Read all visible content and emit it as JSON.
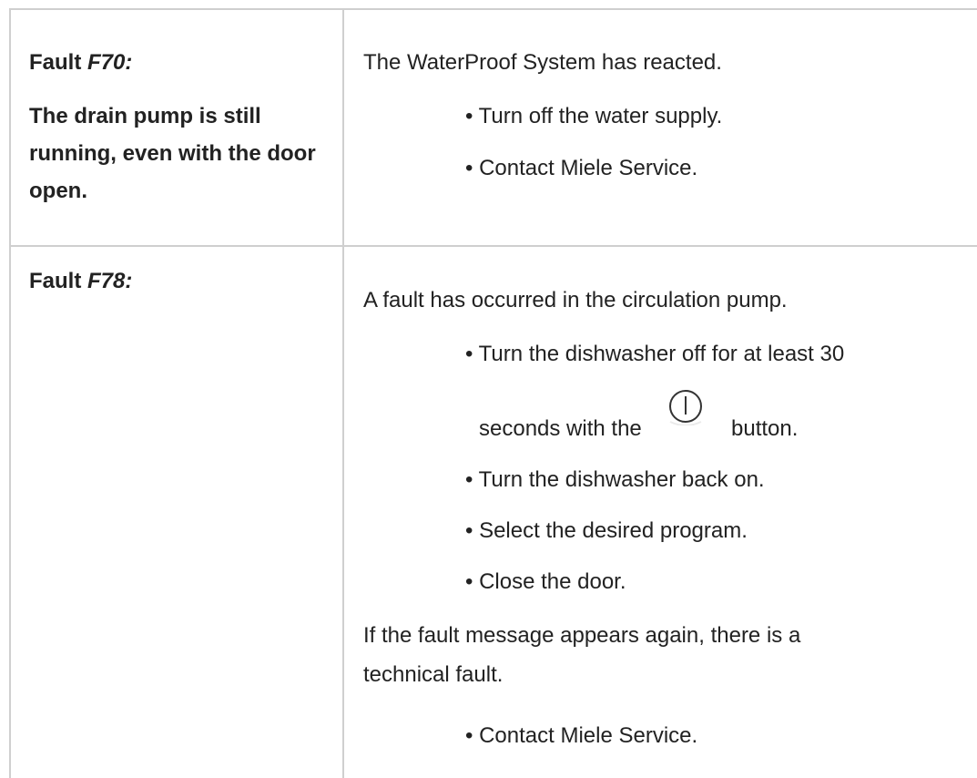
{
  "rows": [
    {
      "fault_prefix": "Fault ",
      "fault_code": "F70:",
      "description": "The drain pump is still running, even with the door open.",
      "message": "The WaterProof System has reacted.",
      "bullets": [
        "• Turn off the water supply.",
        "• Contact Miele Service."
      ]
    },
    {
      "fault_prefix": "Fault ",
      "fault_code": "F78:",
      "message": "A fault has occurred in the circulation pump.",
      "bullets": [
        "• Turn the dishwasher off for at least 30",
        "seconds with the",
        "button.",
        "• Turn the dishwasher back on.",
        "• Select the desired program.",
        "• Close the door."
      ],
      "followup": [
        "If the fault message appears again, there is a",
        "technical fault."
      ],
      "final_bullet": "• Contact Miele Service."
    }
  ],
  "icons": {
    "power": "power-button-icon"
  }
}
